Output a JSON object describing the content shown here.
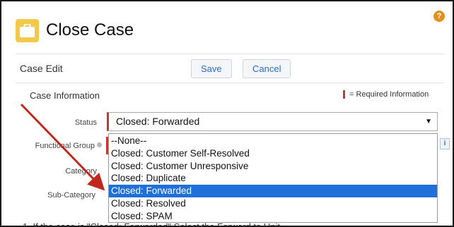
{
  "header": {
    "title": "Close Case",
    "icon": "briefcase-icon",
    "icon_color": "#f2c94c",
    "help_icon": "help-icon",
    "help_glyph": "?"
  },
  "edit_bar": {
    "title": "Case Edit",
    "save_label": "Save",
    "cancel_label": "Cancel"
  },
  "section": {
    "title": "Case Information",
    "required_legend": "= Required Information",
    "required_color": "#c23934"
  },
  "fields": {
    "status_label": "Status",
    "status_value": "Closed: Forwarded",
    "functional_group_label": "Functional Group",
    "category_label": "Category",
    "subcategory_label": "Sub-Category",
    "info_glyph": "i"
  },
  "dropdown": {
    "options": [
      "--None--",
      "Closed: Customer Self-Resolved",
      "Closed: Customer Unresponsive",
      "Closed: Duplicate",
      "Closed: Forwarded",
      "Closed: Resolved",
      "Closed: SPAM"
    ],
    "selected_index": 4,
    "highlight_color": "#1e6fd9"
  },
  "footer": {
    "text": "1. If the case is \"Closed: Forwarded\" Select the Forward to Unit"
  },
  "annotation": {
    "arrow_color": "#c0281e"
  }
}
